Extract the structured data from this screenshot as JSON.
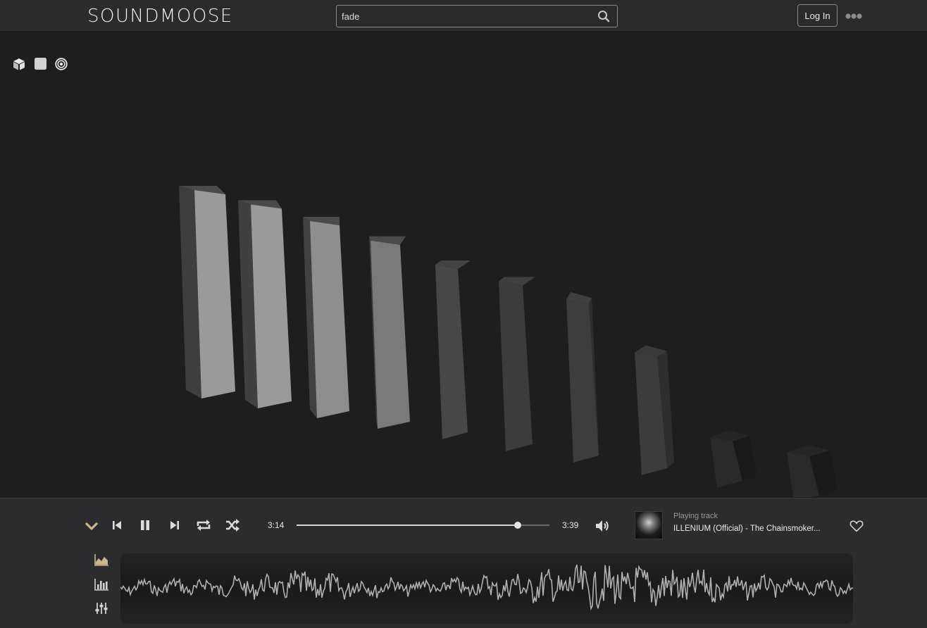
{
  "header": {
    "logo": "SOUNDMOOSE",
    "search": {
      "value": "fade"
    },
    "login_label": "Log In"
  },
  "view_modes": [
    "cube-icon",
    "square-icon",
    "target-icon"
  ],
  "visualizer": {
    "bar_levels": [
      0.95,
      0.93,
      0.9,
      0.86,
      0.8,
      0.78,
      0.75,
      0.57,
      0.25,
      0.25
    ]
  },
  "player": {
    "current_time": "3:14",
    "total_time": "3:39",
    "progress": 0.874,
    "now_playing_label": "Playing track",
    "track_title": "ILLENIUM (Official) - The Chainsmoker...",
    "colors": {
      "accent": "#c9b98a"
    }
  }
}
